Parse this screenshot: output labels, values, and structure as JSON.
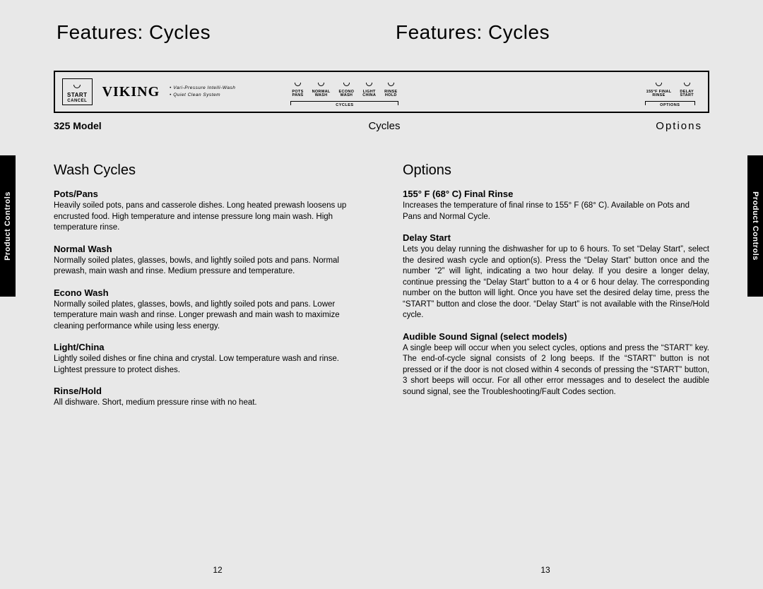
{
  "heading_left": "Features: Cycles",
  "heading_right": "Features: Cycles",
  "side_tab": "Product Controls",
  "panel": {
    "start": {
      "line1": "START",
      "line2": "CANCEL"
    },
    "brand": "VIKING",
    "features": [
      "Vari-Pressure Intelli-Wash",
      "Quiet Clean System"
    ],
    "cycles_group_label": "CYCLES",
    "options_group_label": "OPTIONS",
    "cycle_buttons": [
      {
        "l1": "POTS",
        "l2": "PANS"
      },
      {
        "l1": "NORMAL",
        "l2": "WASH"
      },
      {
        "l1": "ECONO",
        "l2": "WASH"
      },
      {
        "l1": "LIGHT",
        "l2": "CHINA"
      },
      {
        "l1": "RINSE",
        "l2": "HOLD"
      }
    ],
    "option_buttons": [
      {
        "l1": "155°F FINAL",
        "l2": "RINSE"
      },
      {
        "l1": "DELAY",
        "l2": "START"
      }
    ]
  },
  "under": {
    "model": "325 Model",
    "cycles": "Cycles",
    "options": "Options"
  },
  "left": {
    "section": "Wash Cycles",
    "items": [
      {
        "h": "Pots/Pans",
        "p": "Heavily soiled pots, pans and casserole dishes. Long heated prewash loosens up encrusted food. High temperature and intense pressure long main wash. High temperature rinse."
      },
      {
        "h": "Normal Wash",
        "p": "Normally soiled plates, glasses, bowls, and lightly soiled pots and pans. Normal prewash, main wash and rinse. Medium pressure and temperature."
      },
      {
        "h": "Econo Wash",
        "p": "Normally soiled plates, glasses, bowls, and lightly soiled pots and pans. Lower temperature main wash and rinse. Longer prewash and main wash to maximize cleaning performance while using less energy."
      },
      {
        "h": "Light/China",
        "p": "Lightly soiled dishes or fine china and crystal. Low temperature wash and rinse. Lightest pressure to protect dishes."
      },
      {
        "h": "Rinse/Hold",
        "p": "All dishware. Short, medium pressure rinse with no heat."
      }
    ]
  },
  "right": {
    "section": "Options",
    "items": [
      {
        "h": "155° F (68° C) Final Rinse",
        "p": "Increases the temperature of final rinse to 155° F (68° C). Available on Pots and Pans and Normal Cycle."
      },
      {
        "h": "Delay Start",
        "p": "Lets you delay running the dishwasher for up to 6 hours. To set “Delay Start”, select the desired wash cycle and option(s). Press the “Delay Start” button once and the number “2” will light, indicating a two hour delay. If you desire a longer delay, continue pressing the “Delay Start” button to a 4 or 6 hour delay. The corresponding number on the button will light. Once you have set the desired delay time, press the “START” button and close the door. “Delay Start” is not available with the Rinse/Hold cycle.",
        "just": true
      },
      {
        "h": "Audible Sound Signal (select models)",
        "p": "A single beep will occur when you select cycles, options and press the “START” key. The end-of-cycle signal consists of 2 long beeps. If the “START” button is not pressed or if the door is not closed within 4 seconds of pressing the “START” button, 3 short beeps will occur. For all other error messages and to deselect the audible sound signal, see the Troubleshooting/Fault Codes section.",
        "just": true
      }
    ]
  },
  "page_left": "12",
  "page_right": "13"
}
